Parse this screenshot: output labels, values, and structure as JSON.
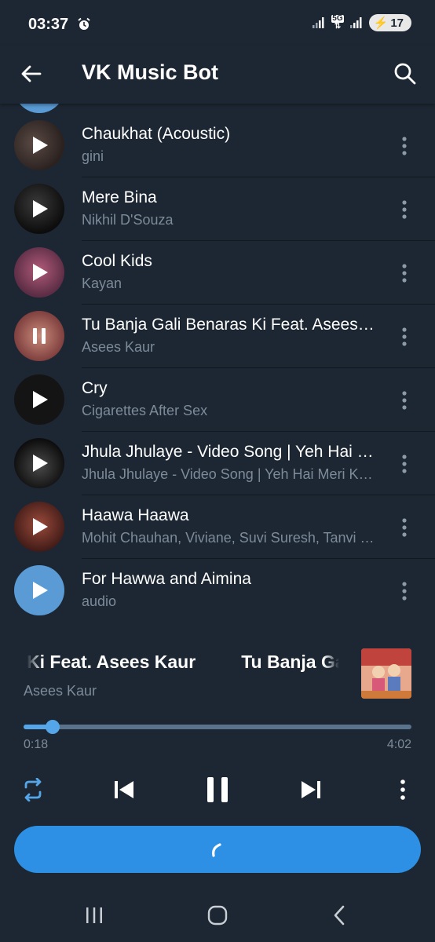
{
  "status": {
    "time": "03:37",
    "network": "5G",
    "battery": "17",
    "icons": [
      "alarm-icon",
      "signal-icon",
      "signal-icon",
      "battery-charging-icon"
    ]
  },
  "header": {
    "title": "VK Music Bot",
    "icons": [
      "back-arrow-icon",
      "search-icon"
    ]
  },
  "tracks": [
    {
      "title": "Chaukhat (Acoustic)",
      "artist": "gini",
      "state": "play"
    },
    {
      "title": "Mere Bina",
      "artist": "Nikhil D'Souza",
      "state": "play"
    },
    {
      "title": "Cool Kids",
      "artist": "Kayan",
      "state": "play"
    },
    {
      "title": "Tu Banja Gali Benaras Ki Feat. Asees Kaur",
      "artist": "Asees Kaur",
      "state": "pause"
    },
    {
      "title": "Cry",
      "artist": "Cigarettes After Sex",
      "state": "play"
    },
    {
      "title": "Jhula Jhulaye - Video Song | Yeh Hai Meri Kahani",
      "artist": "Jhula Jhulaye - Video Song | Yeh Hai Meri Kahani",
      "state": "play"
    },
    {
      "title": "Haawa Haawa",
      "artist": "Mohit Chauhan, Viviane, Suvi Suresh, Tanvi Shah",
      "state": "play"
    },
    {
      "title": "For Hawwa and Aimina",
      "artist": "audio",
      "state": "play"
    }
  ],
  "player": {
    "marquee_part1": "Ki Feat. Asees Kaur",
    "marquee_part2": "Tu Banja Ga",
    "artist": "Asees Kaur",
    "elapsed": "0:18",
    "total": "4:02",
    "progress": 0.075,
    "controls": [
      "repeat-icon",
      "previous-icon",
      "pause-icon",
      "next-icon",
      "more-vertical-icon"
    ],
    "accent": "#2d90e4"
  },
  "colors": {
    "background": "#1d2733",
    "secondary_text": "#7d8b99",
    "accent": "#55a6e8"
  }
}
